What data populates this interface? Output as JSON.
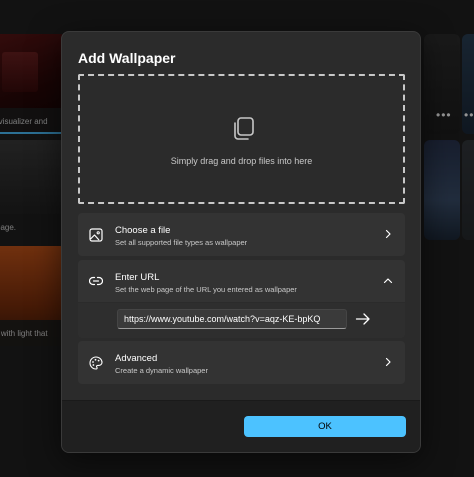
{
  "background": {
    "captions": [
      "rvisualizer and",
      "page.",
      "r with light that"
    ],
    "more_glyph": "•••"
  },
  "dialog": {
    "title": "Add Wallpaper",
    "drop_zone": {
      "icon": "copy-icon",
      "text": "Simply drag and drop files into here"
    },
    "choose_file": {
      "icon": "image-icon",
      "title": "Choose a file",
      "subtitle": "Set all supported file types as wallpaper"
    },
    "enter_url": {
      "icon": "link-icon",
      "title": "Enter URL",
      "subtitle": "Set the web page of the URL you entered as wallpaper",
      "expanded": true,
      "input_value": "https://www.youtube.com/watch?v=aqz-KE-bpKQ"
    },
    "advanced": {
      "icon": "palette-icon",
      "title": "Advanced",
      "subtitle": "Create a dynamic wallpaper"
    },
    "ok_label": "OK"
  },
  "colors": {
    "accent": "#4cc2ff",
    "dialog_bg": "#2b2b2b",
    "card_bg": "#333333"
  }
}
